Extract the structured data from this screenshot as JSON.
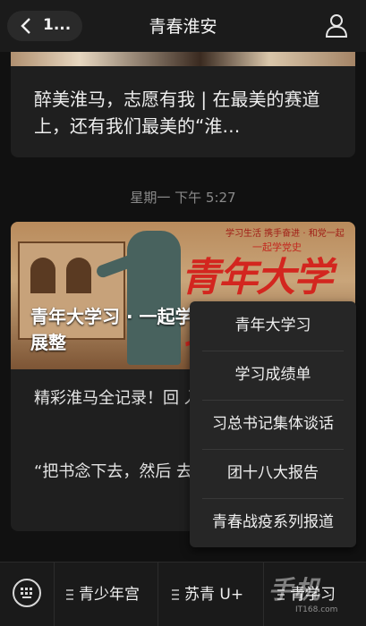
{
  "header": {
    "back_count": "1...",
    "title": "青春淮安"
  },
  "article1": {
    "title": "醉美淮马，志愿有我 | 在最美的赛道上，还有我们最美的“淮…"
  },
  "timestamp": "星期一 下午 5:27",
  "article2": {
    "image_topline": "学习生活 携手奋进 · 和党一起",
    "image_tag": "一起学党史",
    "image_title": "青年大学习",
    "overlay_title": "青年大学习 · 一起学党史 党的建设，开展整",
    "desc1": "精彩淮马全记录！回 入镜了！",
    "desc2": "“把书念下去，然后 去，不枉活一世”，"
  },
  "popup_menu": {
    "items": [
      {
        "label": "青年大学习"
      },
      {
        "label": "学习成绩单"
      },
      {
        "label": "习总书记集体谈话"
      },
      {
        "label": "团十八大报告"
      },
      {
        "label": "青春战疫系列报道"
      }
    ]
  },
  "bottom_bar": {
    "tabs": [
      {
        "label": "青少年宫"
      },
      {
        "label": "苏青 U+"
      },
      {
        "label": "青学习"
      }
    ]
  },
  "watermark": {
    "text": "手机",
    "url": "IT168.com"
  },
  "colors": {
    "background": "#111111",
    "card": "#1f1f1f",
    "menu": "#262626",
    "accent_red": "#d3261f"
  }
}
